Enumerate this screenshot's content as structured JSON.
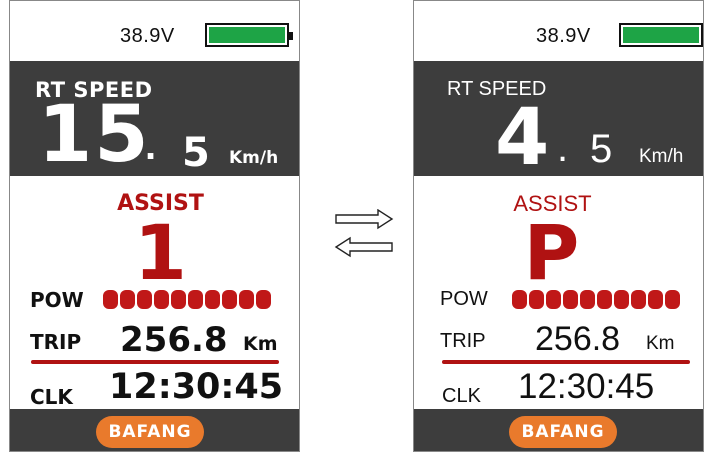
{
  "screens": [
    {
      "voltage": "38.9V",
      "battery_level": 1.0,
      "speed_title": "RT SPEED",
      "speed_int": "15",
      "speed_dot": ".",
      "speed_dec": "5",
      "speed_unit": "Km/h",
      "assist_label": "ASSIST",
      "assist_value": "1",
      "pow_label": "POW",
      "pow_segments": 10,
      "trip_label": "TRIP",
      "trip_value": "256.8",
      "trip_unit": "Km",
      "clk_label": "CLK",
      "clk_value": "12:30:45",
      "logo": "BAFANG"
    },
    {
      "voltage": "38.9V",
      "battery_level": 1.0,
      "speed_title": "RT SPEED",
      "speed_int": "4",
      "speed_dot": ".",
      "speed_dec": "5",
      "speed_unit": "Km/h",
      "assist_label": "ASSIST",
      "assist_value": "P",
      "pow_label": "POW",
      "pow_segments": 10,
      "trip_label": "TRIP",
      "trip_value": "256.8",
      "trip_unit": "Km",
      "clk_label": "CLK",
      "clk_value": "12:30:45",
      "logo": "BAFANG"
    }
  ],
  "colors": {
    "panel": "#3d3d3d",
    "assist_red": "#b01212",
    "battery_green": "#1ea446",
    "logo_orange": "#e97a2c"
  },
  "switch_icon": "swap-arrows-icon"
}
